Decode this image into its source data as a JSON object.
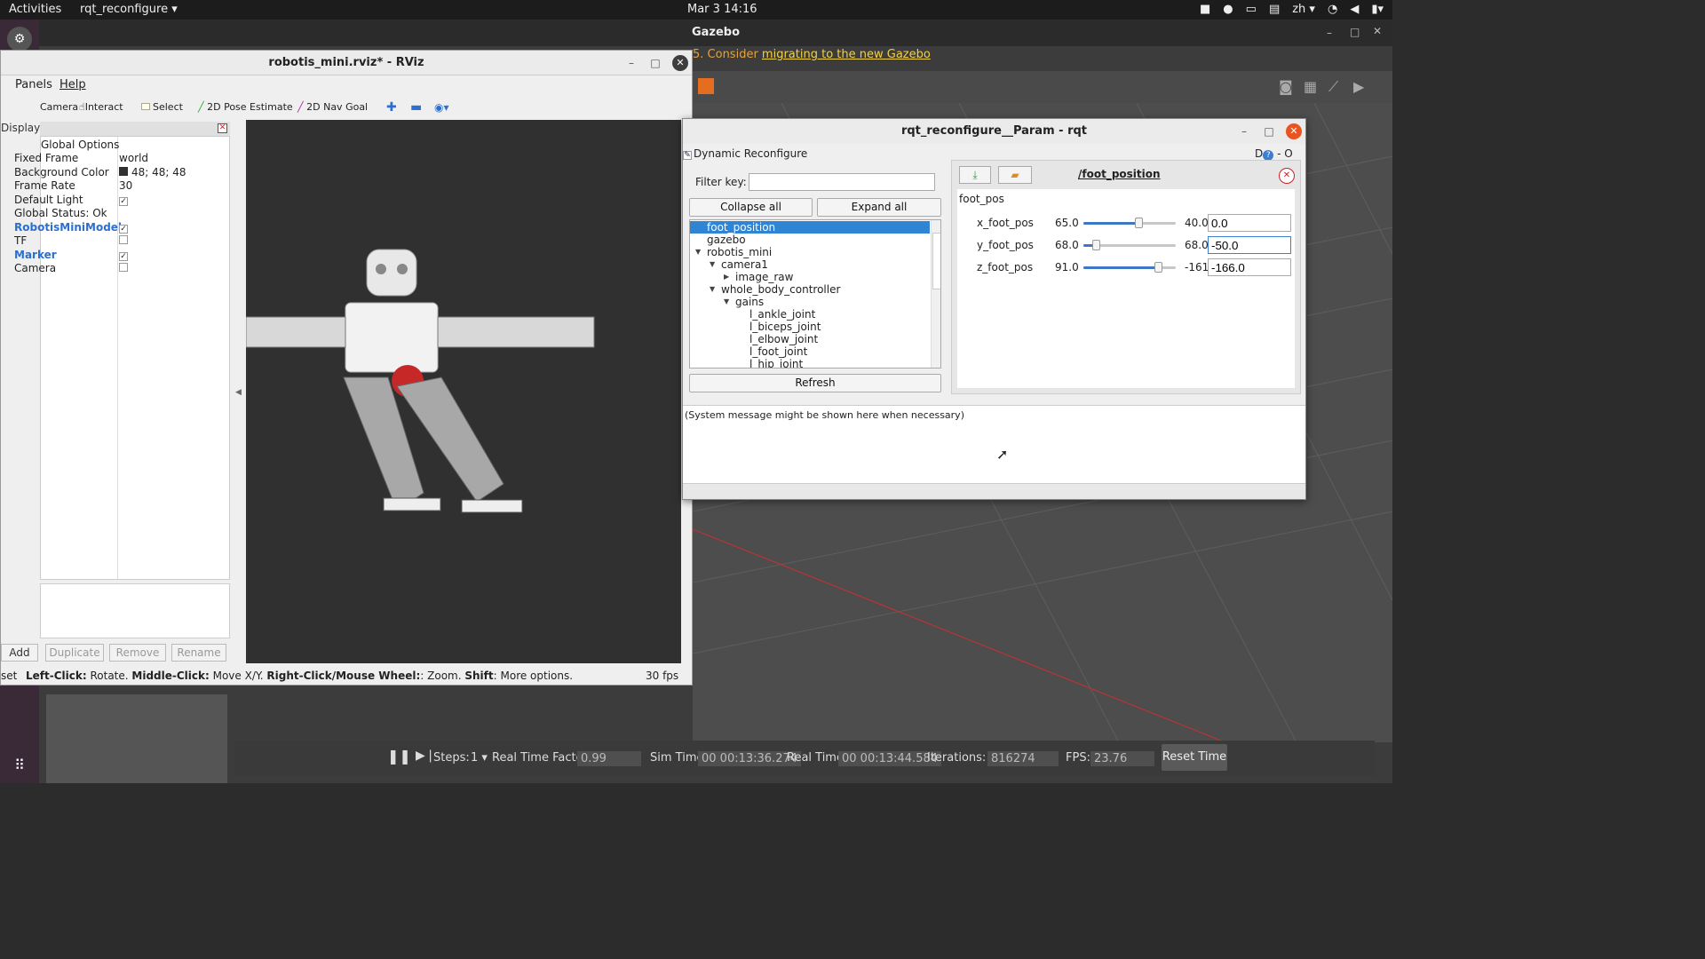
{
  "topbar": {
    "activities": "Activities",
    "app": "rqt_reconfigure ▾",
    "clock": "Mar 3  14:16",
    "lang": "zh ▾"
  },
  "gazebo": {
    "title": "Gazebo",
    "message_prefix": "5. Consider ",
    "message_link": "migrating to the new Gazebo",
    "steps_label": "Steps:",
    "steps_value": "1 ▾",
    "rtf_label": "Real Time Factor:",
    "rtf_value": "0.99",
    "simtime_label": "Sim Time:",
    "simtime_value": "00 00:13:36.274",
    "realtime_label": "Real Time:",
    "realtime_value": "00 00:13:44.584",
    "iter_label": "Iterations:",
    "iter_value": "816274",
    "fps_label": "FPS:",
    "fps_value": "23.76",
    "reset_label": "Reset Time"
  },
  "rviz": {
    "title": "robotis_mini.rviz* - RViz",
    "menu": {
      "panels": "Panels",
      "help": "Help"
    },
    "tools": {
      "camera": "Camera",
      "interact": "Interact",
      "select": "Select",
      "pose": "2D Pose Estimate",
      "nav": "2D Nav Goal"
    },
    "displays_title": "Displays",
    "global_options": "Global Options",
    "rows": [
      {
        "k": "Fixed Frame",
        "v": "world"
      },
      {
        "k": "Background Color",
        "v": "48; 48; 48"
      },
      {
        "k": "Frame Rate",
        "v": "30"
      },
      {
        "k": "Default Light",
        "v": "✓"
      },
      {
        "k": "Global Status: Ok",
        "v": ""
      },
      {
        "k": "RobotisMiniModel",
        "v": "✓"
      },
      {
        "k": "TF",
        "v": ""
      },
      {
        "k": "Marker",
        "v": "✓"
      },
      {
        "k": "Camera",
        "v": ""
      }
    ],
    "buttons": {
      "add": "Add",
      "duplicate": "Duplicate",
      "remove": "Remove",
      "rename": "Rename"
    },
    "status_left": "set",
    "status_text": {
      "a": "Left-Click:",
      "b": " Rotate. ",
      "c": "Middle-Click:",
      "d": " Move X/Y. ",
      "e": "Right-Click/Mouse Wheel:",
      "f": ": Zoom. ",
      "g": "Shift",
      "h": ": More options."
    },
    "fps": "30 fps"
  },
  "rqt": {
    "title": "rqt_reconfigure__Param - rqt",
    "plugin": "Dynamic Reconfigure",
    "filter_label": "Filter key:",
    "collapse": "Collapse all",
    "expand": "Expand all",
    "refresh": "Refresh",
    "tree": [
      {
        "label": "foot_position",
        "indent": 0,
        "arrow": "",
        "selected": true
      },
      {
        "label": "gazebo",
        "indent": 0,
        "arrow": ""
      },
      {
        "label": "robotis_mini",
        "indent": 0,
        "arrow": "▾"
      },
      {
        "label": "camera1",
        "indent": 1,
        "arrow": "▾"
      },
      {
        "label": "image_raw",
        "indent": 2,
        "arrow": "▸"
      },
      {
        "label": "whole_body_controller",
        "indent": 1,
        "arrow": "▾"
      },
      {
        "label": "gains",
        "indent": 2,
        "arrow": "▾"
      },
      {
        "label": "l_ankle_joint",
        "indent": 3,
        "arrow": ""
      },
      {
        "label": "l_biceps_joint",
        "indent": 3,
        "arrow": ""
      },
      {
        "label": "l_elbow_joint",
        "indent": 3,
        "arrow": ""
      },
      {
        "label": "l_foot_joint",
        "indent": 3,
        "arrow": ""
      },
      {
        "label": "l_hip_joint",
        "indent": 3,
        "arrow": ""
      }
    ],
    "node_title": "/foot_position",
    "group": "foot_pos",
    "params": [
      {
        "name": "x_foot_pos",
        "min": "65.0",
        "max": "40.0",
        "value": "0.0",
        "pos": 0.6
      },
      {
        "name": "y_foot_pos",
        "min": "68.0",
        "max": "68.0",
        "value": "-50.0",
        "pos": 0.13
      },
      {
        "name": "z_foot_pos",
        "min": "91.0",
        "max": "-161",
        "value": "-166.0",
        "pos": 0.81
      }
    ],
    "system_message": "(System message might be shown here when necessary)",
    "corner": "D"
  },
  "colors": {
    "accent": "#2f84d3",
    "close": "#e95420",
    "dock": "#3a2a38"
  }
}
